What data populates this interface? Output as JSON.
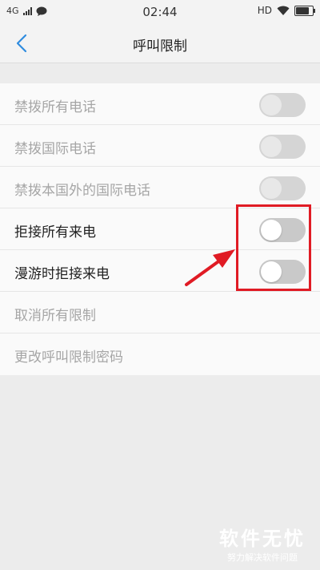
{
  "status_bar": {
    "network": "4G",
    "time": "02:44",
    "hd": "HD",
    "icons": [
      "signal-bars-icon",
      "message-icon",
      "wifi-icon",
      "battery-icon"
    ],
    "battery_level": 0.9
  },
  "header": {
    "title": "呼叫限制",
    "back_icon": "chevron-left-icon"
  },
  "settings": {
    "items": [
      {
        "label": "禁拨所有电话",
        "enabled": false,
        "toggle": "off"
      },
      {
        "label": "禁拨国际电话",
        "enabled": false,
        "toggle": "off"
      },
      {
        "label": "禁拨本国外的国际电话",
        "enabled": false,
        "toggle": "off"
      },
      {
        "label": "拒接所有来电",
        "enabled": true,
        "toggle": "off"
      },
      {
        "label": "漫游时拒接来电",
        "enabled": true,
        "toggle": "off"
      },
      {
        "label": "取消所有限制",
        "enabled": false
      },
      {
        "label": "更改呼叫限制密码",
        "enabled": false
      }
    ]
  },
  "annotation": {
    "color": "#e01b24"
  },
  "watermark": {
    "title": "软件无忧",
    "subtitle": "努力解决软件问题"
  },
  "colors": {
    "accent": "#2f8cdf",
    "background": "#ececec",
    "disabled_text": "#a6a6a6"
  }
}
